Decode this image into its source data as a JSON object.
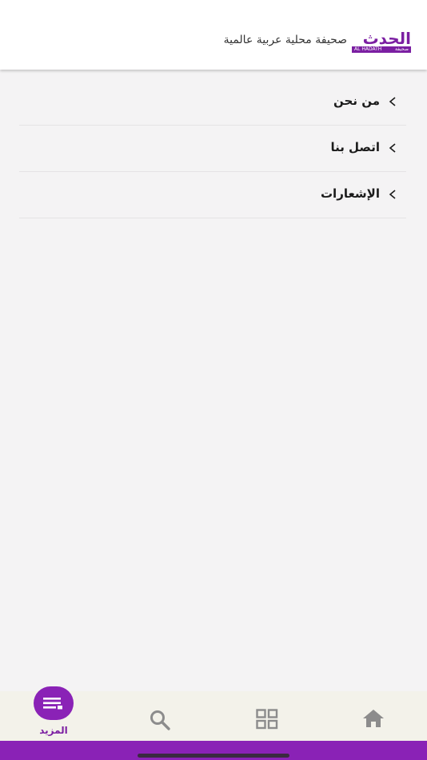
{
  "header": {
    "logo_text": "الحدث",
    "logo_strip_left": "AL HADATH",
    "logo_strip_right": "صحيفة",
    "tagline": "صحيفة محلية عربية عالمية"
  },
  "menu": {
    "items": [
      {
        "label": "من نحن",
        "icon": "chevron-left-icon"
      },
      {
        "label": "اتصل بنا",
        "icon": "chevron-left-icon"
      },
      {
        "label": "الإشعارات",
        "icon": "chevron-left-icon"
      }
    ]
  },
  "tabbar": {
    "more_label": "المزيد",
    "more_icon": "menu-lines-icon",
    "search_icon": "search-icon",
    "sections_icon": "grid-icon",
    "home_icon": "home-icon",
    "active_color": "#8a22b6",
    "inactive_color": "#8c8c8c"
  },
  "colors": {
    "brand": "#7b1fa2",
    "background": "#f4f3f4",
    "header": "#ffffff"
  }
}
